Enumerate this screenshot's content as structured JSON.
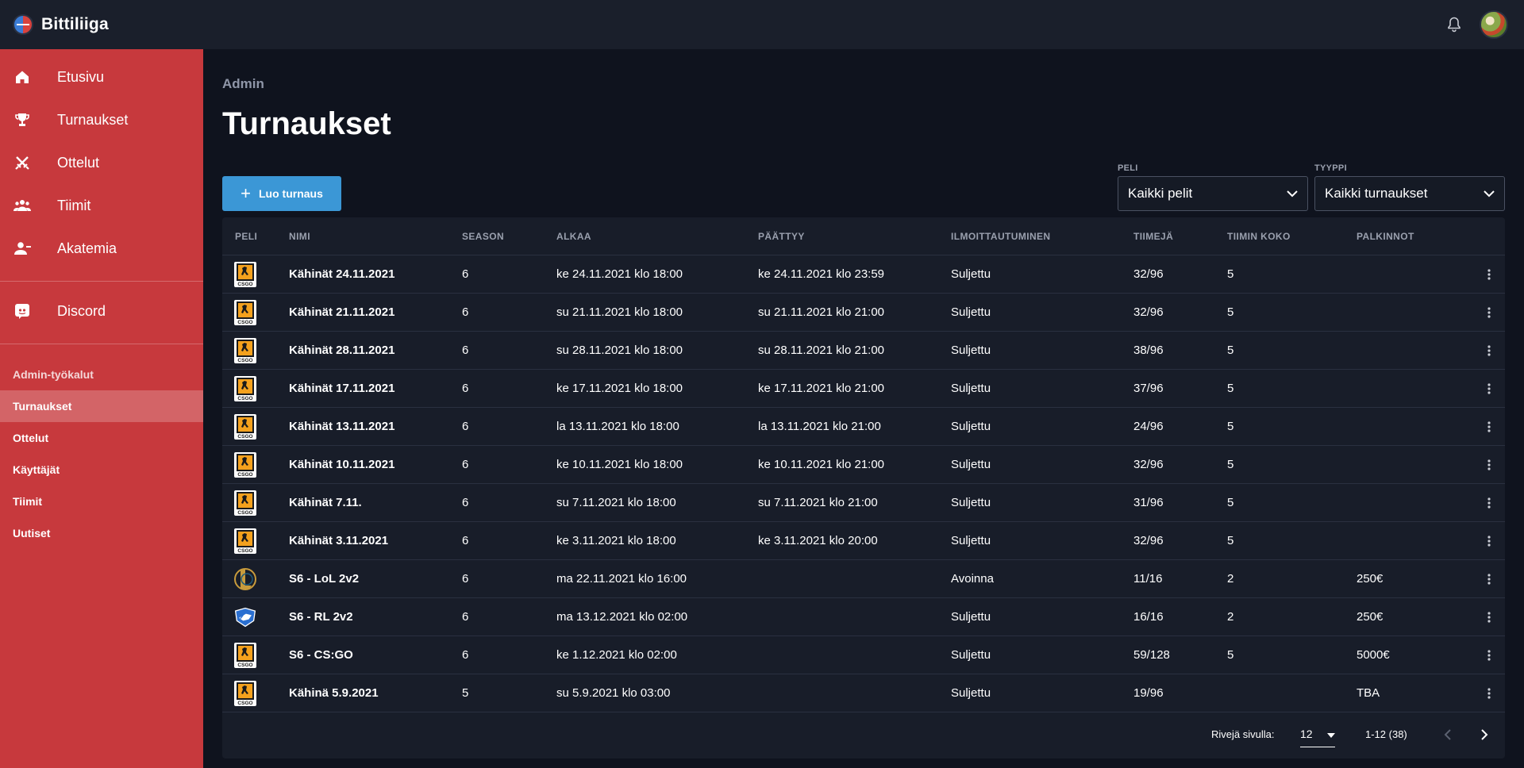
{
  "app": {
    "name": "Bittiliiga"
  },
  "sidebar": {
    "items": [
      {
        "label": "Etusivu",
        "icon": "home-icon"
      },
      {
        "label": "Turnaukset",
        "icon": "trophy-icon"
      },
      {
        "label": "Ottelut",
        "icon": "swords-icon"
      },
      {
        "label": "Tiimit",
        "icon": "team-icon"
      },
      {
        "label": "Akatemia",
        "icon": "person-icon"
      }
    ],
    "discord": {
      "label": "Discord",
      "icon": "discord-icon"
    },
    "admin_header": "Admin-työkalut",
    "admin_items": [
      {
        "label": "Turnaukset",
        "active": true
      },
      {
        "label": "Ottelut"
      },
      {
        "label": "Käyttäjät"
      },
      {
        "label": "Tiimit"
      },
      {
        "label": "Uutiset"
      }
    ]
  },
  "page": {
    "breadcrumb": "Admin",
    "title": "Turnaukset",
    "create_button": "Luo turnaus",
    "filters": {
      "peli": {
        "label": "PELI",
        "value": "Kaikki pelit"
      },
      "tyyppi": {
        "label": "TYYPPI",
        "value": "Kaikki turnaukset"
      }
    }
  },
  "table": {
    "columns": [
      "Peli",
      "Nimi",
      "Season",
      "Alkaa",
      "Päättyy",
      "Ilmoittautuminen",
      "Tiimejä",
      "Tiimin koko",
      "Palkinnot"
    ],
    "rows": [
      {
        "game": "csgo",
        "name": "Kähinät 24.11.2021",
        "season": "6",
        "start": "ke 24.11.2021 klo 18:00",
        "end": "ke 24.11.2021 klo 23:59",
        "registration": "Suljettu",
        "teams": "32/96",
        "team_size": "5",
        "prizes": ""
      },
      {
        "game": "csgo",
        "name": "Kähinät 21.11.2021",
        "season": "6",
        "start": "su 21.11.2021 klo 18:00",
        "end": "su 21.11.2021 klo 21:00",
        "registration": "Suljettu",
        "teams": "32/96",
        "team_size": "5",
        "prizes": ""
      },
      {
        "game": "csgo",
        "name": "Kähinät 28.11.2021",
        "season": "6",
        "start": "su 28.11.2021 klo 18:00",
        "end": "su 28.11.2021 klo 21:00",
        "registration": "Suljettu",
        "teams": "38/96",
        "team_size": "5",
        "prizes": ""
      },
      {
        "game": "csgo",
        "name": "Kähinät 17.11.2021",
        "season": "6",
        "start": "ke 17.11.2021 klo 18:00",
        "end": "ke 17.11.2021 klo 21:00",
        "registration": "Suljettu",
        "teams": "37/96",
        "team_size": "5",
        "prizes": ""
      },
      {
        "game": "csgo",
        "name": "Kähinät 13.11.2021",
        "season": "6",
        "start": "la 13.11.2021 klo 18:00",
        "end": "la 13.11.2021 klo 21:00",
        "registration": "Suljettu",
        "teams": "24/96",
        "team_size": "5",
        "prizes": ""
      },
      {
        "game": "csgo",
        "name": "Kähinät 10.11.2021",
        "season": "6",
        "start": "ke 10.11.2021 klo 18:00",
        "end": "ke 10.11.2021 klo 21:00",
        "registration": "Suljettu",
        "teams": "32/96",
        "team_size": "5",
        "prizes": ""
      },
      {
        "game": "csgo",
        "name": "Kähinät 7.11.",
        "season": "6",
        "start": "su 7.11.2021 klo 18:00",
        "end": "su 7.11.2021 klo 21:00",
        "registration": "Suljettu",
        "teams": "31/96",
        "team_size": "5",
        "prizes": ""
      },
      {
        "game": "csgo",
        "name": "Kähinät 3.11.2021",
        "season": "6",
        "start": "ke 3.11.2021 klo 18:00",
        "end": "ke 3.11.2021 klo 20:00",
        "registration": "Suljettu",
        "teams": "32/96",
        "team_size": "5",
        "prizes": ""
      },
      {
        "game": "lol",
        "name": "S6 - LoL 2v2",
        "season": "6",
        "start": "ma 22.11.2021 klo 16:00",
        "end": "",
        "registration": "Avoinna",
        "teams": "11/16",
        "team_size": "2",
        "prizes": "250€"
      },
      {
        "game": "rl",
        "name": "S6 - RL 2v2",
        "season": "6",
        "start": "ma 13.12.2021 klo 02:00",
        "end": "",
        "registration": "Suljettu",
        "teams": "16/16",
        "team_size": "2",
        "prizes": "250€"
      },
      {
        "game": "csgo",
        "name": "S6 - CS:GO",
        "season": "6",
        "start": "ke 1.12.2021 klo 02:00",
        "end": "",
        "registration": "Suljettu",
        "teams": "59/128",
        "team_size": "5",
        "prizes": "5000€"
      },
      {
        "game": "csgo",
        "name": "Kähinä 5.9.2021",
        "season": "5",
        "start": "su 5.9.2021 klo 03:00",
        "end": "",
        "registration": "Suljettu",
        "teams": "19/96",
        "team_size": "",
        "prizes": "TBA"
      }
    ]
  },
  "pagination": {
    "rows_label": "Rivejä sivulla:",
    "rows_per_page": "12",
    "range": "1-12 (38)"
  },
  "colors": {
    "sidebar": "#c7393d",
    "accent": "#3b97d6",
    "background": "#0f131e",
    "card": "#181d29"
  }
}
